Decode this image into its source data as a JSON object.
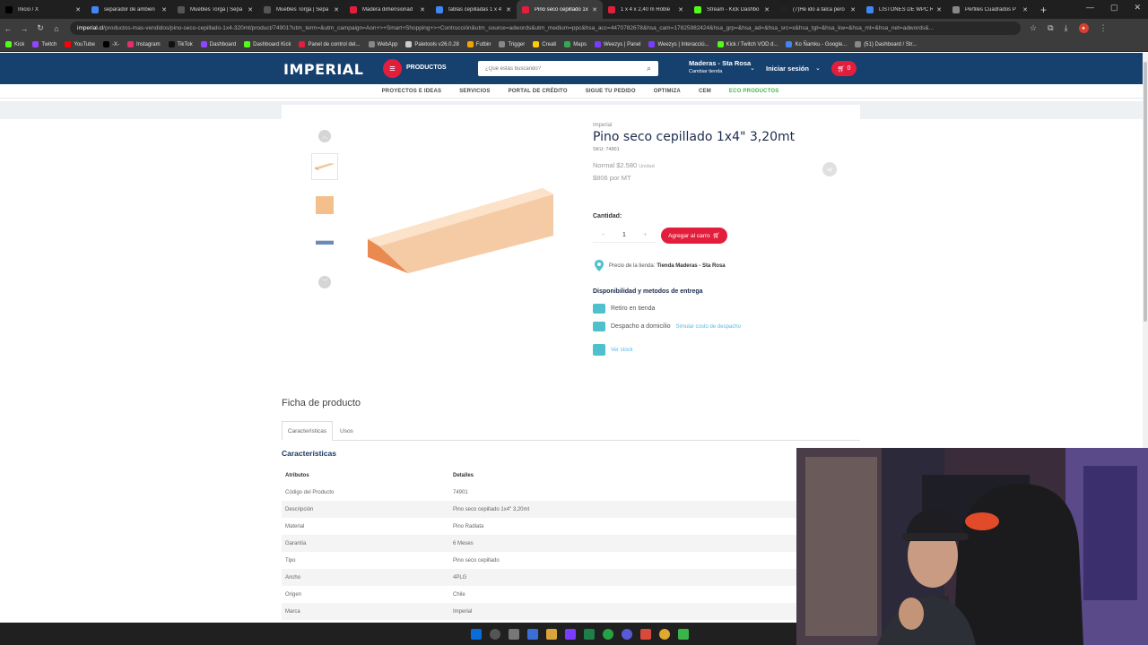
{
  "browser": {
    "tabs": [
      {
        "title": "Inicio / X",
        "color": "#000000"
      },
      {
        "title": "separador de ambien",
        "color": "#4285f4"
      },
      {
        "title": "Muebles Torga | Sepa",
        "color": "#555555"
      },
      {
        "title": "Muebles Torga | Sepa",
        "color": "#555555"
      },
      {
        "title": "Madera dimensionad",
        "color": "#e31e3c"
      },
      {
        "title": "tablas cepilladas 1 x 4",
        "color": "#4285f4"
      },
      {
        "title": "Pino seco cepillado 1x",
        "color": "#e31e3c",
        "active": true
      },
      {
        "title": "1 x 4 x 2,40 m Roble",
        "color": "#e31e3c"
      },
      {
        "title": "Stream - Kick Dashbo",
        "color": "#53fc18"
      },
      {
        "title": "(7)He ido a talca pero",
        "color": "#222222"
      },
      {
        "title": "LISTONES DE WPC RE",
        "color": "#4285f4"
      },
      {
        "title": "Perfiles Cuadrados P",
        "color": "#888888"
      }
    ],
    "url_domain": "imperial.cl",
    "url_rest": "/productos-mas-vendidos/pino-seco-cepillado-1x4-320mt/product/74901?utm_term=&utm_campaign=Aon+>+Smart+Shopping+>+Contrucción&utm_source=adwords&utm_medium=ppc&hsa_acc=4470782678&hsa_cam=17825982424&hsa_grp=&hsa_ad=&hsa_src=x&hsa_tgt=&hsa_kw=&hsa_mt=&hsa_net=adwords&...",
    "bookmarks": [
      {
        "label": "Kick",
        "color": "#53fc18"
      },
      {
        "label": "Twitch",
        "color": "#9146ff"
      },
      {
        "label": "YouTube",
        "color": "#ff0000"
      },
      {
        "label": "-X-",
        "color": "#000000"
      },
      {
        "label": "Instagram",
        "color": "#e1306c"
      },
      {
        "label": "TikTok",
        "color": "#111111"
      },
      {
        "label": "Dashboard",
        "color": "#9146ff"
      },
      {
        "label": "Dashboard Kick",
        "color": "#53fc18"
      },
      {
        "label": "Panel de control del...",
        "color": "#e31e3c"
      },
      {
        "label": "WebApp",
        "color": "#888888"
      },
      {
        "label": "Paletools v26.0.28",
        "color": "#cccccc"
      },
      {
        "label": "Futbin",
        "color": "#f0a500"
      },
      {
        "label": "Trigger",
        "color": "#888888"
      },
      {
        "label": "Creati",
        "color": "#ffcc00"
      },
      {
        "label": "Maps",
        "color": "#34a853"
      },
      {
        "label": "Weezys | Panel",
        "color": "#7a3cff"
      },
      {
        "label": "Weezys | Interacciú...",
        "color": "#7a3cff"
      },
      {
        "label": "Kick / Twitch VOD d...",
        "color": "#53fc18"
      },
      {
        "label": "Ko Ñamku - Google...",
        "color": "#4285f4"
      },
      {
        "label": "(51) Dashboard / Str...",
        "color": "#888888"
      }
    ]
  },
  "header": {
    "logo": "IMPERIAL",
    "menu_label": "PRODUCTOS",
    "search_placeholder": "¿Qué estás buscando?",
    "store_name": "Maderas - Sta Rosa",
    "store_change": "Cambiar tienda",
    "login": "Iniciar sesión",
    "cart_count": "0"
  },
  "subnav": [
    "PROYECTOS E IDEAS",
    "SERVICIOS",
    "PORTAL DE CRÉDITO",
    "SIGUE TU PEDIDO",
    "OPTIMIZA",
    "CEM",
    "ECO PRODUCTOS"
  ],
  "product": {
    "brand": "Imperial",
    "title": "Pino seco cepillado 1x4\" 3,20mt",
    "sku": "SKU: 74901",
    "price_normal": "Normal $2.580",
    "price_unit": "Unidad",
    "price_per_mt": "$806 por MT",
    "qty_label": "Cantidad:",
    "qty_value": "1",
    "add_to_cart": "Agregar al carro",
    "store_price_prefix": "Precio de la tienda:",
    "store_price_name": "Tienda Maderas - Sta Rosa",
    "availability_title": "Disponibilidad y metodos de entrega",
    "pickup": "Retiro en tienda",
    "delivery": "Despacho a domicilio",
    "delivery_link": "Simular costo de despacho",
    "stock_link": "Ver stock"
  },
  "ficha": {
    "title": "Ficha de producto",
    "tabs": [
      "Características",
      "Usos"
    ],
    "section": "Características",
    "headers": [
      "Atributos",
      "Detalles"
    ],
    "rows": [
      [
        "Código del Producto",
        "74901"
      ],
      [
        "Descripción",
        "Pino seco cepillado 1x4\" 3,20mt"
      ],
      [
        "Material",
        "Pino Radiata"
      ],
      [
        "Garantía",
        "6 Meses"
      ],
      [
        "Tipo",
        "Pino seco cepillado"
      ],
      [
        "Ancho",
        "4PLG"
      ],
      [
        "Origen",
        "Chile"
      ],
      [
        "Marca",
        "Imperial"
      ]
    ]
  },
  "colors": {
    "brand_blue": "#16406e",
    "accent_red": "#e31e3c",
    "eco_green": "#46b44a",
    "teal": "#4ec1cc"
  }
}
